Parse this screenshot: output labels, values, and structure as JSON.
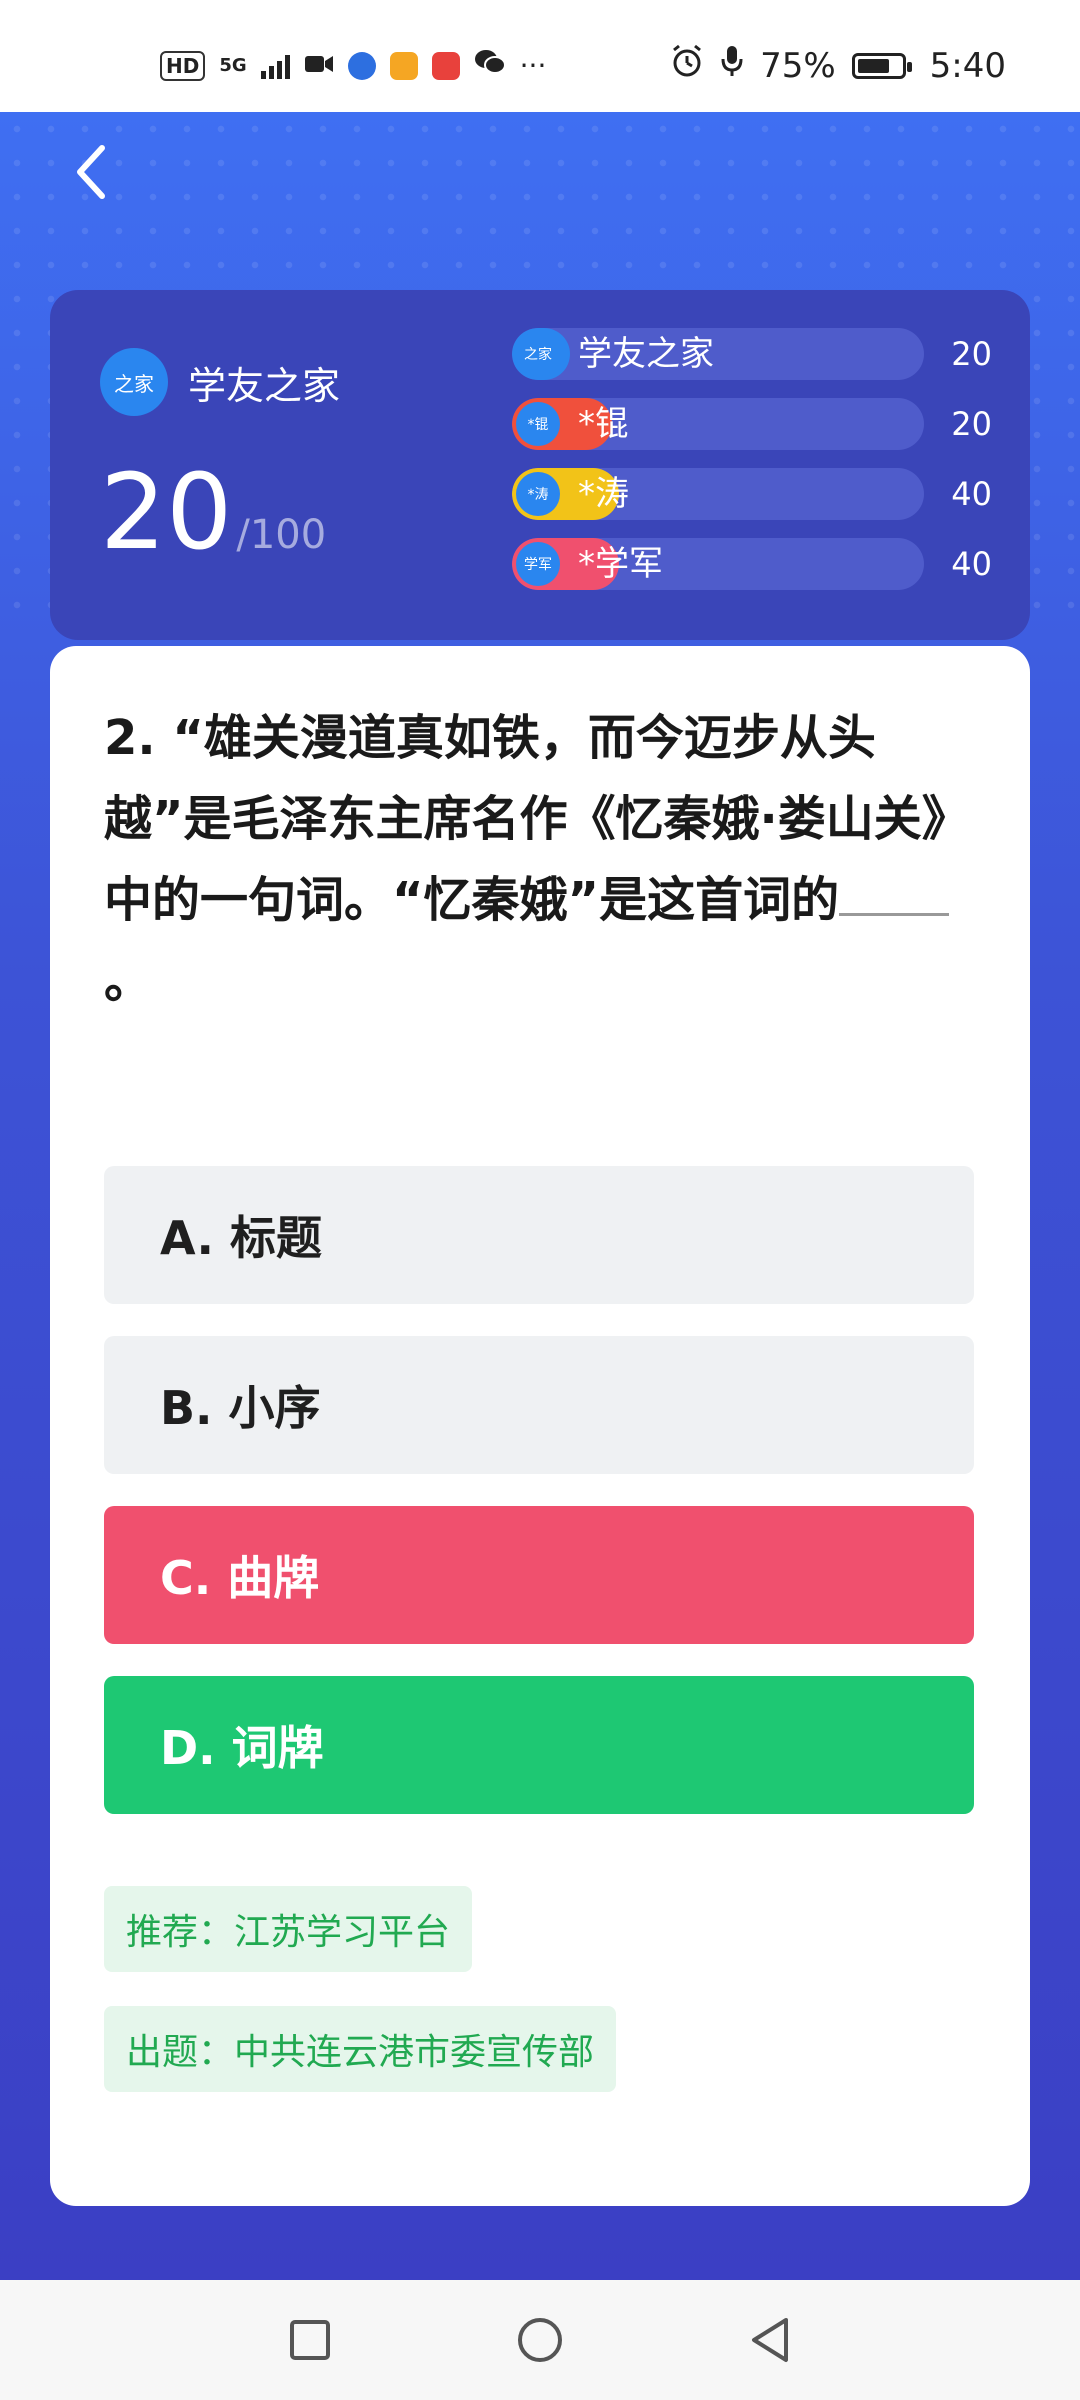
{
  "status_bar": {
    "hd": "HD",
    "network": "5G",
    "battery_text": "75%",
    "battery_level": 0.75,
    "time": "5:40",
    "more": "···"
  },
  "scoreboard": {
    "me": {
      "avatar_text": "之家",
      "name": "学友之家",
      "score": "20",
      "total": "/100"
    },
    "players": [
      {
        "avatar_text": "之家",
        "name": "学友之家",
        "score": "20",
        "fill": 0.14,
        "color": "#2a86ef"
      },
      {
        "avatar_text": "*锟",
        "name": "*锟",
        "score": "20",
        "fill": 0.13,
        "color": "#f0503c"
      },
      {
        "avatar_text": "*涛",
        "name": "*涛",
        "score": "40",
        "fill": 0.26,
        "color": "#f2c318"
      },
      {
        "avatar_text": "学军",
        "name": "*学军",
        "score": "40",
        "fill": 0.26,
        "color": "#f0506e"
      }
    ]
  },
  "question": {
    "text": "2. “雄关漫道真如铁，而今迈步从头越”是毛泽东主席名作《忆秦娥·娄山关》中的一句词。“忆秦娥”是这首词的",
    "tail": "。"
  },
  "options": [
    {
      "label": "A. 标题",
      "state": "normal"
    },
    {
      "label": "B. 小序",
      "state": "normal"
    },
    {
      "label": "C. 曲牌",
      "state": "wrong"
    },
    {
      "label": "D. 词牌",
      "state": "correct"
    }
  ],
  "tags": {
    "recommend": "推荐：江苏学习平台",
    "source": "出题：中共连云港市委宣传部"
  },
  "colors": {
    "wrong": "#f0506e",
    "correct": "#1ec873",
    "tag_green": "#21a951"
  }
}
